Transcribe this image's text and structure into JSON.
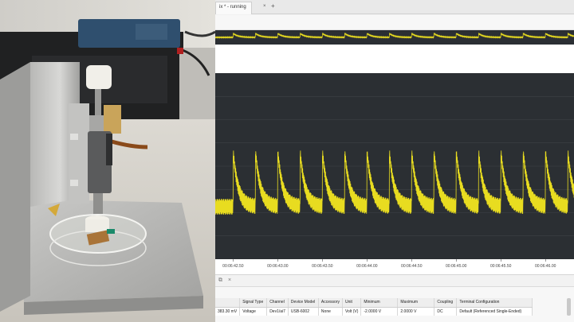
{
  "tab": {
    "title": "ix * - running",
    "close_glyph": "×",
    "add_glyph": "+"
  },
  "time_axis": {
    "ticks": [
      "00:06:42.50",
      "00:06:43.00",
      "00:06:43.50",
      "00:06:44.00",
      "00:06:44.50",
      "00:06:45.00",
      "00:06:45.50",
      "00:06:46.00"
    ]
  },
  "panel_bar": {
    "copy_icon": "⧉",
    "close_icon": "×"
  },
  "channel_table": {
    "columns": [
      "",
      "Signal Type",
      "Channel",
      "Device Model",
      "Accessory",
      "Unit",
      "Minimum",
      "Maximum",
      "Coupling",
      "Terminal Configuration"
    ],
    "rows": [
      [
        "383.30 mV",
        "Voltage",
        "Dev1/ai7",
        "USB-6002",
        "None",
        "Volt (V)",
        "-2.0000 V",
        "2.0000 V",
        "DC",
        "Default (Referenced Single-Ended)"
      ]
    ]
  },
  "chart_data": {
    "type": "line",
    "series": [
      {
        "color": "#e8dc20"
      }
    ],
    "x": [
      42.3,
      42.5,
      42.75,
      43.0,
      43.25,
      43.5,
      43.75,
      44.0,
      44.25,
      44.5,
      44.75,
      45.0,
      45.25,
      45.5,
      45.75,
      46.0,
      46.25,
      46.32
    ],
    "xlim": [
      42.3,
      46.32
    ],
    "peak_times": [
      42.5,
      42.75,
      43.0,
      43.25,
      43.5,
      43.75,
      44.0,
      44.25,
      44.5,
      44.75,
      45.0,
      45.25,
      45.5,
      45.75,
      46.0,
      46.25
    ],
    "grid": true,
    "colors": {
      "background": "#2b2f33",
      "trace": "#e8dc20",
      "grid": "#40454a"
    }
  }
}
